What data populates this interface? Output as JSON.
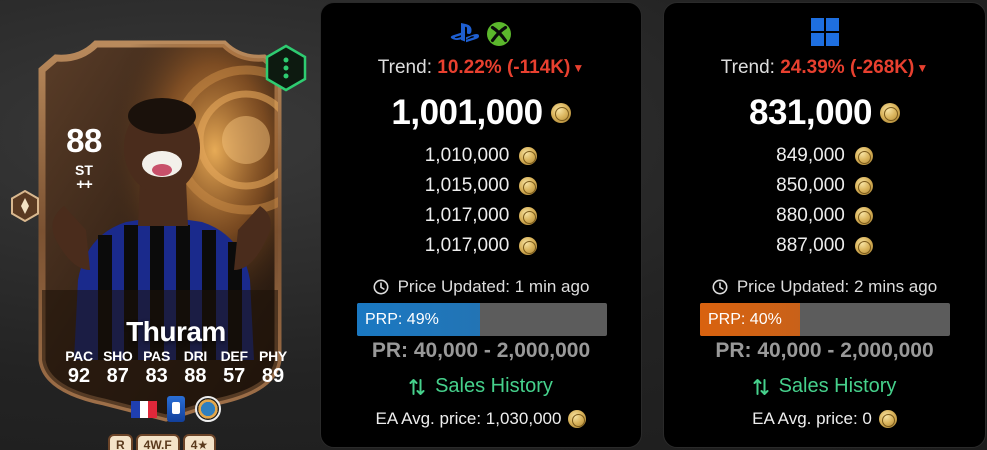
{
  "card": {
    "rating": "88",
    "position": "ST",
    "position_plus": "++",
    "name": "Thuram",
    "stats": [
      {
        "label": "PAC",
        "value": "92"
      },
      {
        "label": "SHO",
        "value": "87"
      },
      {
        "label": "PAS",
        "value": "83"
      },
      {
        "label": "DRI",
        "value": "88"
      },
      {
        "label": "DEF",
        "value": "57"
      },
      {
        "label": "PHY",
        "value": "89"
      }
    ],
    "badges": [
      "R",
      "4W.F",
      "4★"
    ],
    "icons": {
      "nation": "france-flag-icon",
      "league": "serie-a-logo-icon",
      "club": "inter-club-badge-icon",
      "playstyle": "playstyle-plus-hex-icon",
      "evolution": "evolution-hex-icon"
    },
    "colors": {
      "frame": "#7a5030",
      "accent_green": "#2ecc71"
    }
  },
  "panels": [
    {
      "id": "console",
      "platform_icons": [
        "playstation-icon",
        "xbox-icon"
      ],
      "trend_label": "Trend:",
      "trend_value": "10.22% (-114K)",
      "main_price": "1,001,000",
      "prices": [
        "1,010,000",
        "1,015,000",
        "1,017,000",
        "1,017,000"
      ],
      "updated_text": "Price Updated: 1 min ago",
      "prp_text": "PRP: 49%",
      "prp_percent": 49,
      "prp_color": "#1a78c2",
      "pr_range": "PR: 40,000 - 2,000,000",
      "sales_history": "Sales History",
      "ea_avg": "EA Avg. price: 1,030,000"
    },
    {
      "id": "pc",
      "platform_icons": [
        "windows-icon"
      ],
      "trend_label": "Trend:",
      "trend_value": "24.39% (-268K)",
      "main_price": "831,000",
      "prices": [
        "849,000",
        "850,000",
        "880,000",
        "887,000"
      ],
      "updated_text": "Price Updated: 2 mins ago",
      "prp_text": "PRP: 40%",
      "prp_percent": 40,
      "prp_color": "#d9620f",
      "pr_range": "PR: 40,000 - 2,000,000",
      "sales_history": "Sales History",
      "ea_avg": "EA Avg. price: 0"
    }
  ],
  "colors": {
    "trend_red": "#e8402f",
    "sales_green": "#46d18c",
    "coin_gold": "#d9b35b"
  }
}
